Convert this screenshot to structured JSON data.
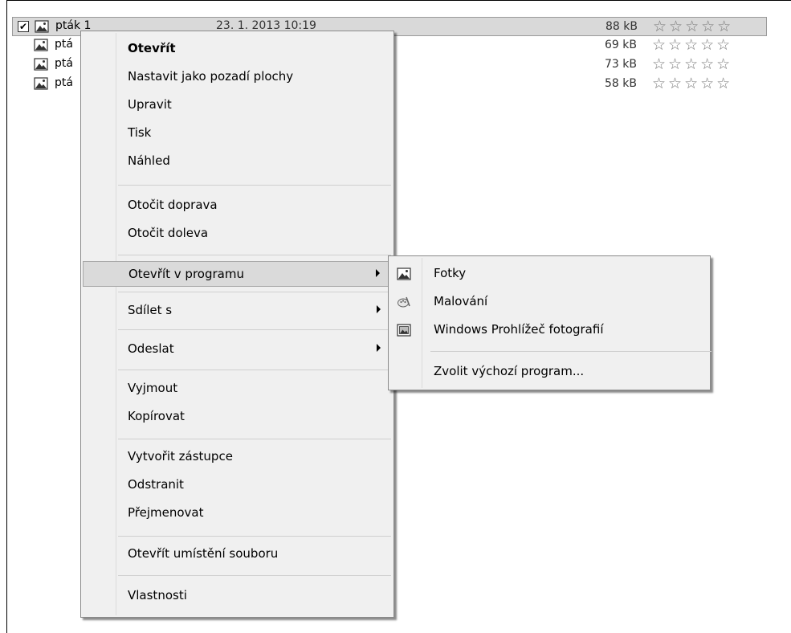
{
  "files": [
    {
      "name": "pták 1",
      "date": "23. 1. 2013 10:19",
      "size": "88 kB",
      "stars": "☆☆☆☆☆",
      "selected": true,
      "checked": "✔"
    },
    {
      "name": "ptá",
      "date": "",
      "size": "69 kB",
      "stars": "☆☆☆☆☆",
      "selected": false,
      "checked": ""
    },
    {
      "name": "ptá",
      "date": "",
      "size": "73 kB",
      "stars": "☆☆☆☆☆",
      "selected": false,
      "checked": ""
    },
    {
      "name": "ptá",
      "date": "",
      "size": "58 kB",
      "stars": "☆☆☆☆☆",
      "selected": false,
      "checked": ""
    }
  ],
  "context_menu": {
    "open": "Otevřít",
    "set_desktop": "Nastavit jako pozadí plochy",
    "edit": "Upravit",
    "print": "Tisk",
    "preview": "Náhled",
    "rotate_right": "Otočit doprava",
    "rotate_left": "Otočit doleva",
    "open_with": "Otevřít v programu",
    "share_with": "Sdílet s",
    "send_to": "Odeslat",
    "cut": "Vyjmout",
    "copy": "Kopírovat",
    "create_shortcut": "Vytvořit zástupce",
    "delete": "Odstranit",
    "rename": "Přejmenovat",
    "open_location": "Otevřít umístění souboru",
    "properties": "Vlastnosti"
  },
  "open_with_submenu": {
    "photos": "Fotky",
    "paint": "Malování",
    "photo_viewer": "Windows Prohlížeč fotografií",
    "choose_default": "Zvolit výchozí program..."
  },
  "icons": {
    "image_file": "image-file-icon",
    "photos_app": "photos-app-icon",
    "paint_app": "paint-palette-icon",
    "photo_viewer_app": "photo-viewer-icon"
  },
  "colors": {
    "selection_bg": "#d9d9d9",
    "menu_bg": "#f0f0f0",
    "highlight_bg": "#dadada"
  }
}
